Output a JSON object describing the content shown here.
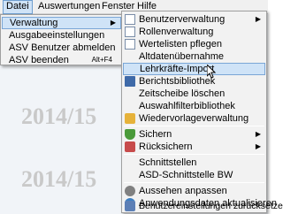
{
  "menubar": {
    "items": [
      {
        "label": "Datei"
      },
      {
        "label": "Auswertungen"
      },
      {
        "label": "Fenster"
      },
      {
        "label": "Hilfe"
      }
    ]
  },
  "workspace": {
    "watermarks": [
      "2014/15",
      "2014/15"
    ]
  },
  "file_menu": {
    "items": [
      {
        "label": "Verwaltung",
        "has_submenu": true
      },
      {
        "label": "Ausgabeeinstellungen"
      },
      {
        "label": "ASV Benutzer abmelden"
      },
      {
        "label": "ASV beenden",
        "shortcut": "Alt+F4"
      }
    ]
  },
  "verwaltung_menu": {
    "items": [
      {
        "label": "Benutzerverwaltung",
        "icon": "document-icon",
        "has_submenu": true
      },
      {
        "label": "Rollenverwaltung",
        "icon": "document-icon"
      },
      {
        "label": "Wertelisten pflegen",
        "icon": "document-icon"
      },
      {
        "label": "Altdatenübernahme",
        "icon": ""
      },
      {
        "label": "Lehrkräfte-Import",
        "icon": "",
        "highlighted": true
      },
      {
        "label": "Berichtsbibliothek",
        "icon": "book-icon"
      },
      {
        "label": "Zeitscheibe löschen",
        "icon": ""
      },
      {
        "label": "Auswahlfilterbibliothek",
        "icon": ""
      },
      {
        "label": "Wiedervorlageverwaltung",
        "icon": "checkmark-icon"
      },
      {
        "label": "Sichern",
        "icon": "shield-icon",
        "has_submenu": true
      },
      {
        "label": "Rücksichern",
        "icon": "restore-icon",
        "has_submenu": true
      },
      {
        "label": "Schnittstellen",
        "icon": ""
      },
      {
        "label": "ASD-Schnittstelle BW",
        "icon": ""
      },
      {
        "label": "Aussehen anpassen",
        "icon": "gear-icon"
      },
      {
        "label": "Anwendungsdaten aktualisieren",
        "icon": "globe-icon"
      },
      {
        "label": "Benutzereinstellungen zurücksetzen",
        "icon": "user-icon"
      }
    ]
  },
  "glyphs": {
    "submenu_arrow": "▶"
  },
  "colors": {
    "highlight_bg": "#cfe3f7",
    "highlight_border": "#7aa6d6",
    "menu_bg": "#f2f2f2"
  }
}
